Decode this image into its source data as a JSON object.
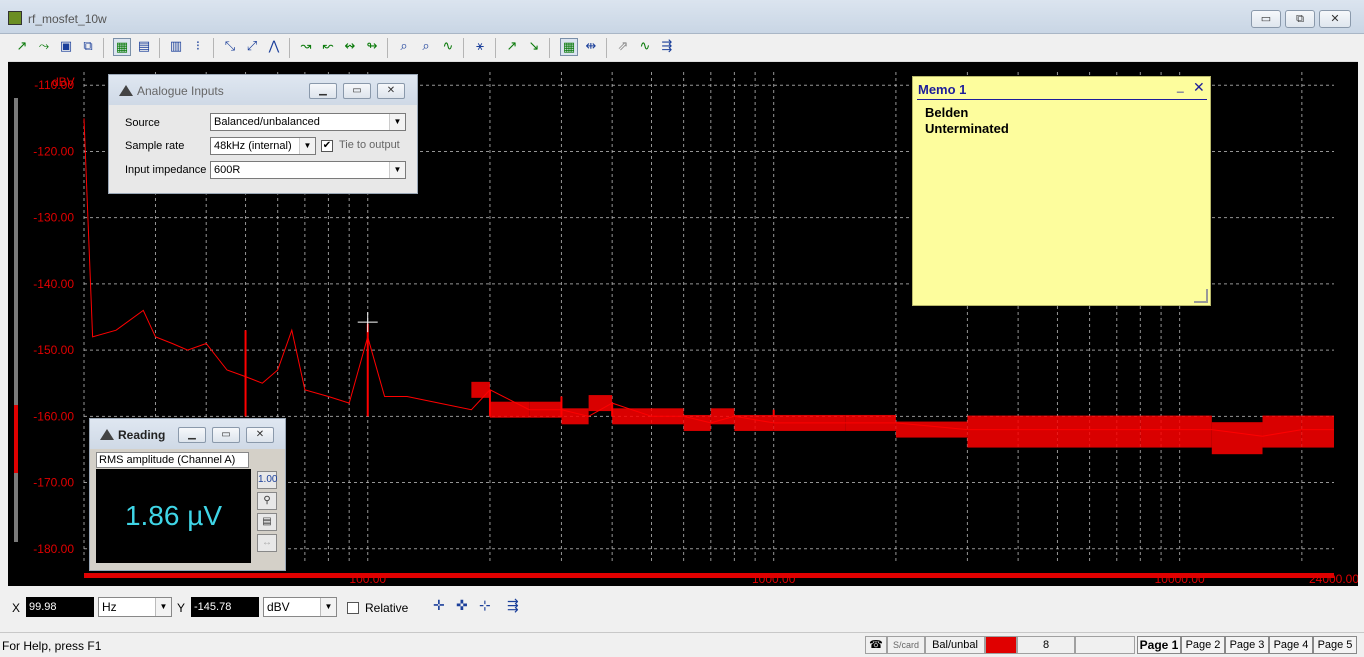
{
  "window": {
    "title": "rf_mosfet_10w",
    "min": "▭",
    "max": "⧉",
    "close": "✕"
  },
  "toolbar": {
    "icons": [
      "↗",
      "⤳",
      "▣",
      "⧉",
      "▦",
      "▤",
      "▥",
      "⁝",
      "⤡",
      "⤢",
      "⋀",
      "↝",
      "↜",
      "↭",
      "↬",
      "⌕",
      "⌕",
      "∿",
      "⚹",
      "↗",
      "↘",
      "▦",
      "⇹",
      "⇗",
      "∿",
      "⇶"
    ]
  },
  "analogue_inputs": {
    "title": "Analogue Inputs",
    "source_label": "Source",
    "source_value": "Balanced/unbalanced",
    "sample_rate_label": "Sample rate",
    "sample_rate_value": "48kHz (internal)",
    "tie_label": "Tie to output",
    "tie_checked": "✔",
    "impedance_label": "Input impedance",
    "impedance_value": "600R"
  },
  "reading": {
    "title": "Reading",
    "label": "RMS amplitude (Channel A)",
    "value": "1.86 µV",
    "tool1": "1.00"
  },
  "memo": {
    "title": "Memo 1",
    "line1": "Belden",
    "line2": "Unterminated"
  },
  "cursor": {
    "x_label": "X",
    "x_value": "99.98",
    "x_unit": "Hz",
    "y_label": "Y",
    "y_value": "-145.78",
    "y_unit": "dBV",
    "relative_label": "Relative"
  },
  "status": {
    "help": "For Help, press F1",
    "scard": "S/card",
    "input": "Bal/unbal",
    "count": "8",
    "pages": [
      "Page 1",
      "Page 2",
      "Page 3",
      "Page 4",
      "Page 5"
    ]
  },
  "chart_data": {
    "type": "line",
    "title": "",
    "xlabel": "",
    "ylabel": "dBV",
    "x_scale": "log",
    "xlim": [
      20,
      24000
    ],
    "ylim": [
      -182,
      -108
    ],
    "grid": true,
    "trace_color": "#ff0000",
    "y_ticks": [
      "-110.00",
      "-120.00",
      "-130.00",
      "-140.00",
      "-150.00",
      "-160.00",
      "-170.00",
      "-180.00"
    ],
    "x_ticks": [
      "100.00",
      "1000.00",
      "10000.00",
      "24000.00"
    ],
    "series": [
      {
        "x": [
          20,
          21,
          24,
          28,
          30,
          33,
          36,
          40,
          45,
          50,
          55,
          60,
          65,
          70,
          80,
          90,
          100,
          110,
          125,
          150,
          180,
          200,
          250,
          300,
          350,
          400,
          500,
          600,
          700,
          800,
          1000,
          1500,
          2000,
          3000,
          5000,
          8000,
          12000,
          16000,
          20000,
          24000
        ],
        "y": [
          -115,
          -148,
          -147,
          -144,
          -148,
          -149,
          -150,
          -149,
          -153,
          -154,
          -155,
          -153,
          -147,
          -156,
          -157,
          -158,
          -148,
          -157,
          -157,
          -158,
          -159,
          -156,
          -159,
          -159,
          -160,
          -158,
          -160,
          -160,
          -161,
          -160,
          -161,
          -161,
          -161,
          -162,
          -162,
          -162,
          -162,
          -163,
          -162,
          -162
        ]
      }
    ],
    "peaks": [
      {
        "x": 50,
        "y": -147
      },
      {
        "x": 100,
        "y": -146
      },
      {
        "x": 200,
        "y": -156
      },
      {
        "x": 300,
        "y": -157
      },
      {
        "x": 400,
        "y": -158
      },
      {
        "x": 1000,
        "y": -159
      }
    ]
  }
}
